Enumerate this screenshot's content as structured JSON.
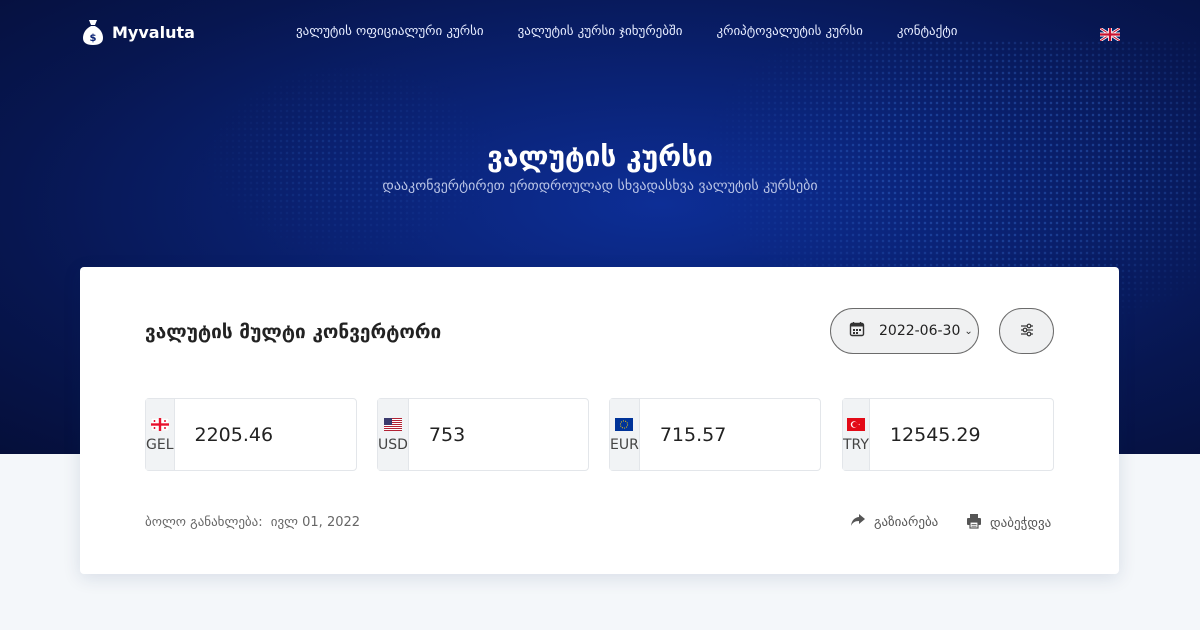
{
  "brand": {
    "name": "Myvaluta"
  },
  "nav": {
    "links": [
      {
        "label": "ვალუტის ოფიციალური კურსი"
      },
      {
        "label": "ვალუტის კურსი ჯიხურებში"
      },
      {
        "label": "კრიპტოვალუტის კურსი"
      },
      {
        "label": "კონტაქტი"
      }
    ],
    "language_icon": "uk-flag-icon"
  },
  "hero": {
    "title": "ვალუტის კურსი",
    "subtitle": "დააკონვერტირეთ ერთდროულად სხვადასხვა ვალუტის კურსები"
  },
  "converter": {
    "title": "ვალუტის მულტი კონვერტორი",
    "date": "2022-06-30",
    "currencies": [
      {
        "code": "GEL",
        "value": "2205.46",
        "flag_icon": "georgia-flag-icon"
      },
      {
        "code": "USD",
        "value": "753",
        "flag_icon": "usa-flag-icon"
      },
      {
        "code": "EUR",
        "value": "715.57",
        "flag_icon": "eu-flag-icon"
      },
      {
        "code": "TRY",
        "value": "12545.29",
        "flag_icon": "turkey-flag-icon"
      }
    ],
    "last_update_label": "ბოლო განახლება:",
    "last_update_date": "ივლ 01, 2022",
    "share_label": "გაზიარება",
    "print_label": "დაბეჭდვა"
  },
  "colors": {
    "hero_bg": "#0a2274",
    "card_bg": "#ffffff",
    "page_bg": "#f4f7fa"
  }
}
